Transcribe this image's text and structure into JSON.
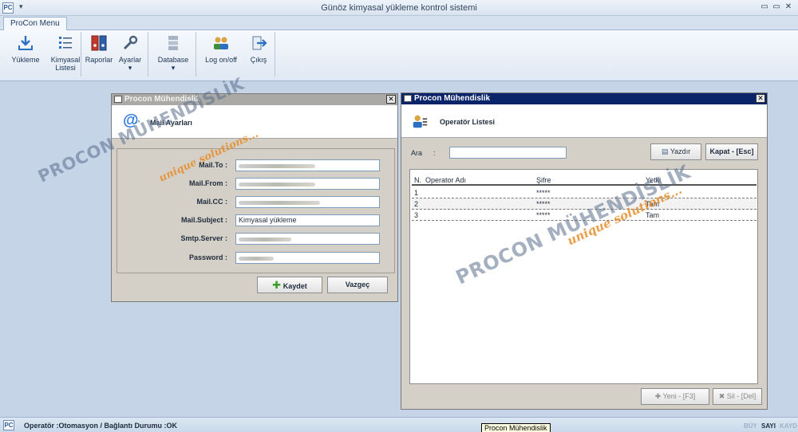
{
  "window": {
    "title": "Günöz kimyasal yükleme kontrol sistemi",
    "icon_text": "PC",
    "qat_arrow": "▾",
    "controls": [
      "▭",
      "▭",
      "✕"
    ]
  },
  "ribbon": {
    "tab": "ProCon Menu",
    "buttons": [
      {
        "label": "Yükleme",
        "icon": "upload-icon"
      },
      {
        "label": "Kimyasal Listesi",
        "icon": "list-icon"
      },
      {
        "label": "Raporlar",
        "icon": "binders-icon"
      },
      {
        "label": "Ayarlar",
        "icon": "wrench-icon"
      },
      {
        "label": "Database",
        "icon": "database-icon"
      },
      {
        "label": "Log on/off",
        "icon": "users-icon"
      },
      {
        "label": "Çıkış",
        "icon": "exit-icon"
      }
    ],
    "dropdown_glyph": "▾"
  },
  "mail_window": {
    "title": "Procon Mühendislik",
    "header": "Mail Ayarları",
    "header_icon": "@",
    "close": "✕",
    "fields": [
      {
        "label": "Mail.To :",
        "value": ""
      },
      {
        "label": "Mail.From :",
        "value": ""
      },
      {
        "label": "Mail.CC :",
        "value": ""
      },
      {
        "label": "Mail.Subject :",
        "value": "Kimyasal yükleme"
      },
      {
        "label": "Smtp.Server :",
        "value": ""
      },
      {
        "label": "Password :",
        "value": ""
      }
    ],
    "save_button": "Kaydet",
    "cancel_button": "Vazgeç"
  },
  "operator_window": {
    "title": "Procon Mühendislik",
    "header": "Operatör Listesi",
    "close": "✕",
    "search_label": "Ara",
    "search_colon": ":",
    "search_value": "",
    "print_button": "Yazdır",
    "close_button": "Kapat - [Esc]",
    "columns": [
      "N.",
      "Operator Adı",
      "Şifre",
      "Yetki"
    ],
    "rows": [
      {
        "n": "1",
        "name": "",
        "password": "*****",
        "role": ""
      },
      {
        "n": "2",
        "name": "",
        "password": "*****",
        "role": "Tam"
      },
      {
        "n": "3",
        "name": "",
        "password": "*****",
        "role": "Tam"
      }
    ],
    "new_button": "Yeni - [F3]",
    "delete_button": "Sil - [Del]"
  },
  "watermark": {
    "main": "PROCON MÜHENDİSLİK",
    "sub": "unique solutions..."
  },
  "status": {
    "text": "Operatör :Otomasyon / Bağlantı Durumu :OK",
    "tooltip": "Procon Mühendislik",
    "indicators": [
      "BÜY",
      "SAYI",
      "KAYD"
    ]
  }
}
